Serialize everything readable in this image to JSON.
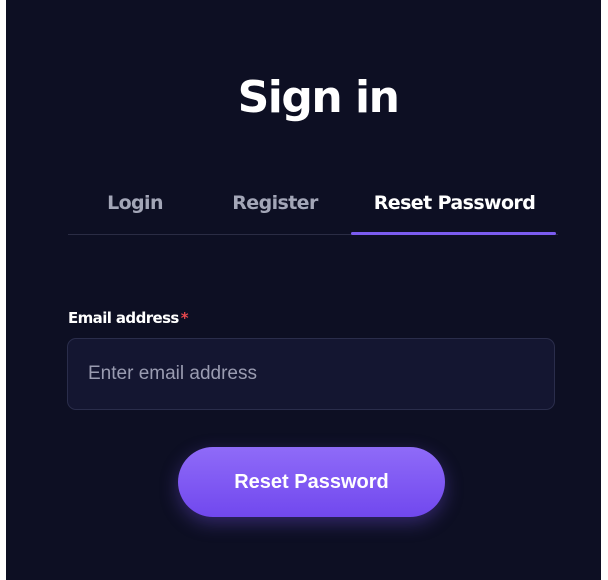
{
  "header": {
    "title": "Sign in"
  },
  "tabs": [
    {
      "label": "Login",
      "active": false
    },
    {
      "label": "Register",
      "active": false
    },
    {
      "label": "Reset Password",
      "active": true
    }
  ],
  "form": {
    "email_label": "Email address",
    "required_mark": "*",
    "email_placeholder": "Enter email address",
    "email_value": "",
    "submit_label": "Reset Password"
  },
  "colors": {
    "background": "#0d0f23",
    "accent": "#7b5cf0",
    "required": "#e5484d",
    "input_background": "#141631"
  }
}
